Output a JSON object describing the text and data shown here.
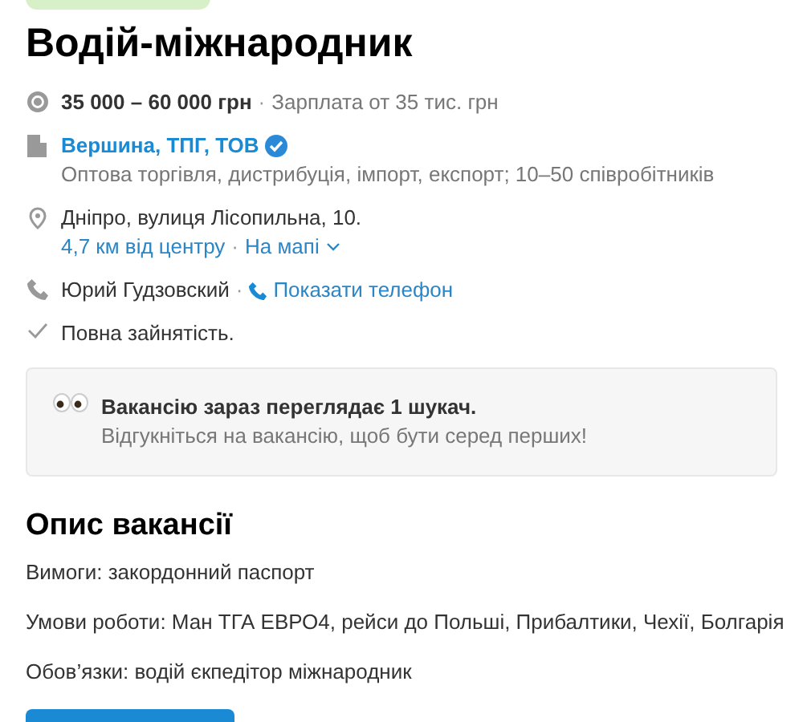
{
  "top_bar": {
    "badge": {
      "kind": "badge"
    }
  },
  "title": "Водій-міжнародник",
  "details": [
    {
      "kind": "salary",
      "main": "35 000 – 60 000 грн",
      "separator": "·",
      "extra": "Зарплата от 35 тис. грн"
    },
    {
      "kind": "company",
      "name": "Вершина, ТПГ, ТОВ",
      "verified": true,
      "description": "Оптова торгівля, дистрибуція, імпорт, експорт; 10–50 співробітників"
    },
    {
      "kind": "address",
      "address": "Дніпро, вулиця Лісопильна, 10.",
      "distance": "4,7 км від центру",
      "separator": "·",
      "map_link": "На мапі"
    },
    {
      "kind": "contact",
      "name": "Юрий Гудзовский",
      "separator": "·",
      "phone_link": "Показати телефон"
    },
    {
      "kind": "employment",
      "text": "Повна зайнятість."
    }
  ],
  "notice": {
    "title": "Вакансію зараз переглядає 1 шукач.",
    "text": "Відгукніться на вакансію, щоб бути серед перших!"
  },
  "description": {
    "heading": "Опис вакансії",
    "paragraphs": [
      "Вимоги: закордонний паспорт",
      "Умови роботи: Ман ТГА ЕВРО4, рейси до Польші, Прибалтики, Чехії, Болгарія",
      "Обов’язки: водій єкпедітор міжнародник"
    ]
  }
}
